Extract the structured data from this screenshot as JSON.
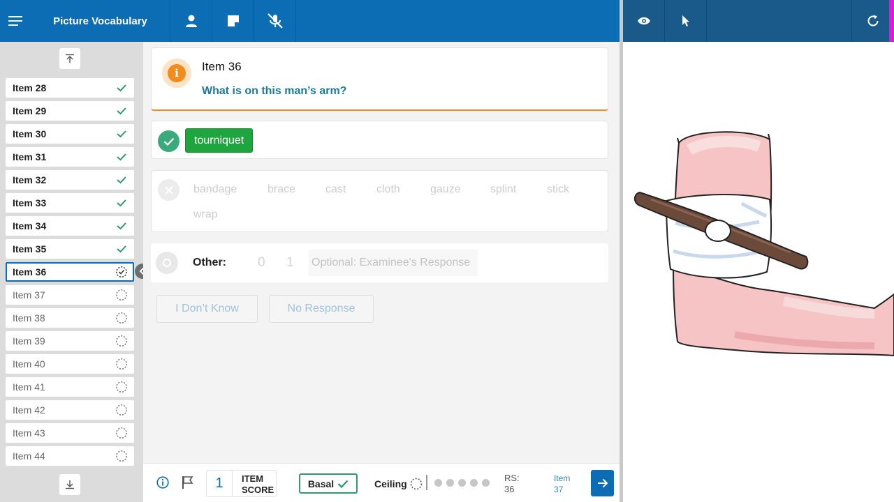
{
  "header": {
    "title": "Picture Vocabulary",
    "icons": [
      "menu-icon",
      "person-icon",
      "note-icon",
      "mic-off-icon"
    ]
  },
  "right_toolbar": {
    "icons": [
      "eye-icon",
      "pointer-icon",
      "refresh-icon"
    ]
  },
  "sidebar": {
    "items": [
      {
        "label": "Item 28",
        "status": "done"
      },
      {
        "label": "Item 29",
        "status": "done"
      },
      {
        "label": "Item 30",
        "status": "done"
      },
      {
        "label": "Item 31",
        "status": "done"
      },
      {
        "label": "Item 32",
        "status": "done"
      },
      {
        "label": "Item 33",
        "status": "done"
      },
      {
        "label": "Item 34",
        "status": "done"
      },
      {
        "label": "Item 35",
        "status": "done"
      },
      {
        "label": "Item 36",
        "status": "current"
      },
      {
        "label": "Item 37",
        "status": "pending"
      },
      {
        "label": "Item 38",
        "status": "pending"
      },
      {
        "label": "Item 39",
        "status": "pending"
      },
      {
        "label": "Item 40",
        "status": "pending"
      },
      {
        "label": "Item 41",
        "status": "pending"
      },
      {
        "label": "Item 42",
        "status": "pending"
      },
      {
        "label": "Item 43",
        "status": "pending"
      },
      {
        "label": "Item 44",
        "status": "pending"
      }
    ]
  },
  "question": {
    "item_label": "Item 36",
    "prompt": "What is on this man’s arm?"
  },
  "correct_answer": "tourniquet",
  "incorrect_answers": [
    "bandage",
    "brace",
    "cast",
    "cloth",
    "gauze",
    "splint",
    "stick",
    "wrap"
  ],
  "other": {
    "label": "Other:",
    "score_options": [
      "0",
      "1"
    ],
    "placeholder": "Optional: Examinee's Response"
  },
  "actions": {
    "dont_know": "I Don’t Know",
    "no_response": "No Response"
  },
  "footer": {
    "item_score_value": "1",
    "item_score_label_1": "ITEM",
    "item_score_label_2": "SCORE",
    "basal_label": "Basal",
    "ceiling_label": "Ceiling",
    "rs_label": "RS:",
    "rs_value": "36",
    "next_item_label": "Item",
    "next_item_number": "37",
    "progress_dots": 5
  },
  "colors": {
    "primary": "#0d6db4",
    "correct": "#1fa53d",
    "accent_orange": "#f28c1e",
    "question_text": "#1b7a9a"
  }
}
